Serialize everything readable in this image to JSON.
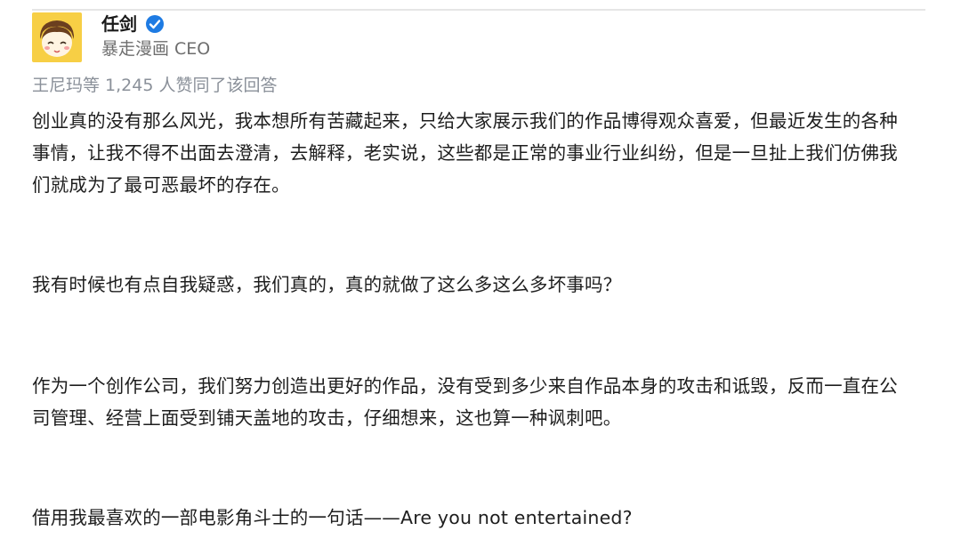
{
  "author": {
    "name": "任剑",
    "title": "暴走漫画 CEO",
    "avatar_icon": "cartoon-avatar-icon",
    "verified_icon": "verified-badge-icon",
    "verified_color": "#1e7be3"
  },
  "vote_line": "王尼玛等 1,245 人赞同了该回答",
  "paragraphs": [
    "创业真的没有那么风光，我本想所有苦藏起来，只给大家展示我们的作品博得观众喜爱，但最近发生的各种事情，让我不得不出面去澄清，去解释，老实说，这些都是正常的事业行业纠纷，但是一旦扯上我们仿佛我们就成为了最可恶最坏的存在。",
    "我有时候也有点自我疑惑，我们真的，真的就做了这么多这么多坏事吗？",
    "作为一个创作公司，我们努力创造出更好的作品，没有受到多少来自作品本身的攻击和诋毁，反而一直在公司管理、经营上面受到铺天盖地的攻击，仔细想来，这也算一种讽刺吧。",
    "借用我最喜欢的一部电影角斗士的一句话——Are you not entertained?"
  ]
}
